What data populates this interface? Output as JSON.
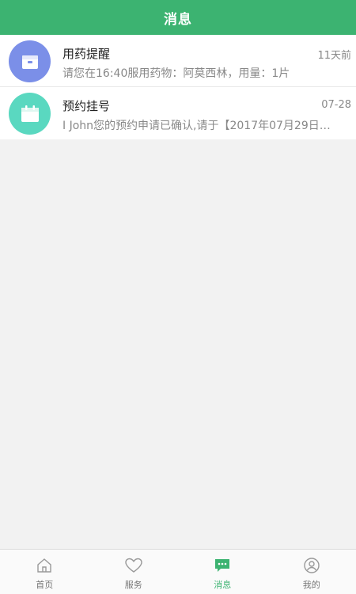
{
  "header": {
    "title": "消息"
  },
  "messages": [
    {
      "title": "用药提醒",
      "time": "11天前",
      "preview": "请您在16:40服用药物：阿莫西林，用量：1片",
      "icon": "medicine-box-icon",
      "avatar_color": "#7b8fe8"
    },
    {
      "title": "预约挂号",
      "time": "07-28",
      "preview": "I John您的预约申请已确认,请于【2017年07月29日…",
      "icon": "calendar-icon",
      "avatar_color": "#5ad8c0"
    }
  ],
  "tabbar": {
    "items": [
      {
        "label": "首页",
        "icon": "home-icon",
        "active": false
      },
      {
        "label": "服务",
        "icon": "heart-icon",
        "active": false
      },
      {
        "label": "消息",
        "icon": "message-icon",
        "active": true
      },
      {
        "label": "我的",
        "icon": "profile-icon",
        "active": false
      }
    ]
  },
  "colors": {
    "primary": "#3cb371",
    "background": "#f2f2f2",
    "inactive": "#999999"
  }
}
